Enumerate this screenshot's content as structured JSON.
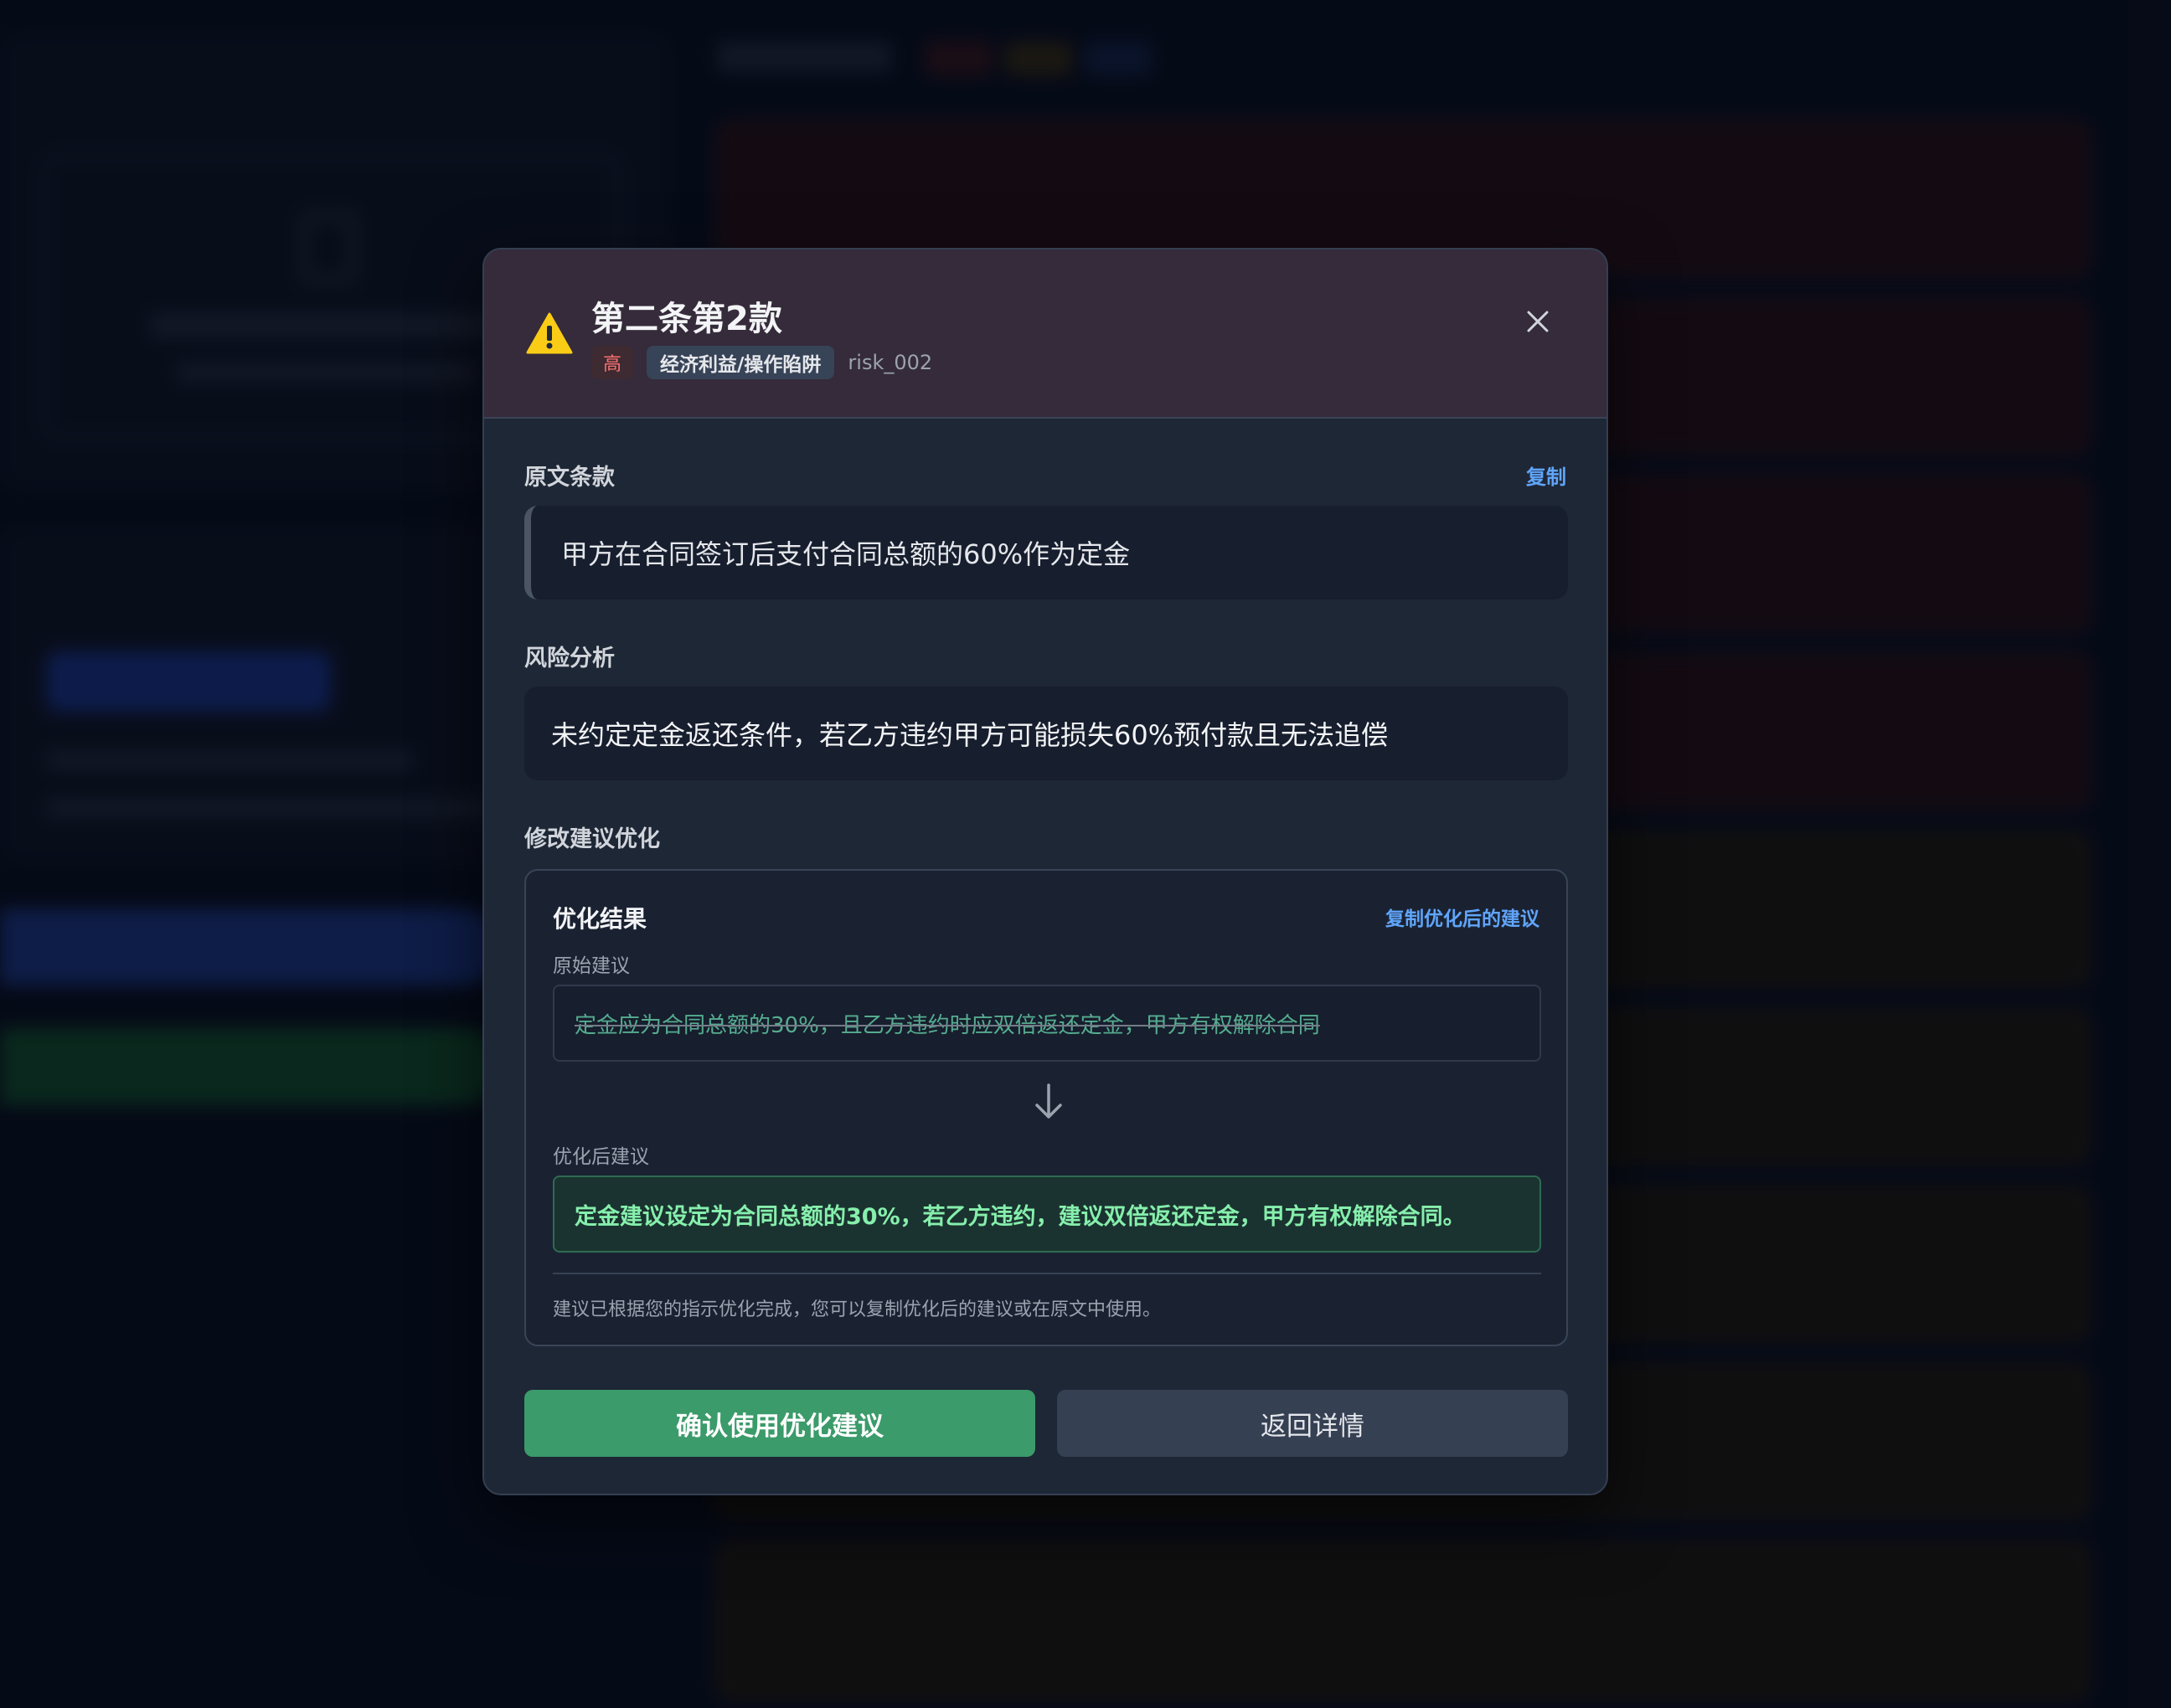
{
  "modal": {
    "title": "第二条第2款",
    "severity": "高",
    "category": "经济利益/操作陷阱",
    "risk_id": "risk_002",
    "original_clause_label": "原文条款",
    "copy_label": "复制",
    "original_clause_text": "甲方在合同签订后支付合同总额的60%作为定金",
    "risk_analysis_label": "风险分析",
    "risk_analysis_text": "未约定定金返还条件，若乙方违约甲方可能损失60%预付款且无法追偿",
    "optimize_section_label": "修改建议优化",
    "optimize": {
      "title": "优化结果",
      "copy_optimized_label": "复制优化后的建议",
      "original_suggestion_label": "原始建议",
      "original_suggestion_text": "定金应为合同总额的30%，且乙方违约时应双倍返还定金，甲方有权解除合同",
      "optimized_suggestion_label": "优化后建议",
      "optimized_suggestion_text": "定金建议设定为合同总额的30%，若乙方违约，建议双倍返还定金，甲方有权解除合同。",
      "note": "建议已根据您的指示优化完成，您可以复制优化后的建议或在原文中使用。"
    },
    "confirm_label": "确认使用优化建议",
    "back_label": "返回详情"
  },
  "colors": {
    "accent_green": "#3b9b6a",
    "link_blue": "#60a5fa",
    "severity_red": "#f87171",
    "warning_yellow": "#facc15"
  },
  "icons": [
    "warning-icon",
    "close-icon",
    "arrow-down-icon"
  ]
}
